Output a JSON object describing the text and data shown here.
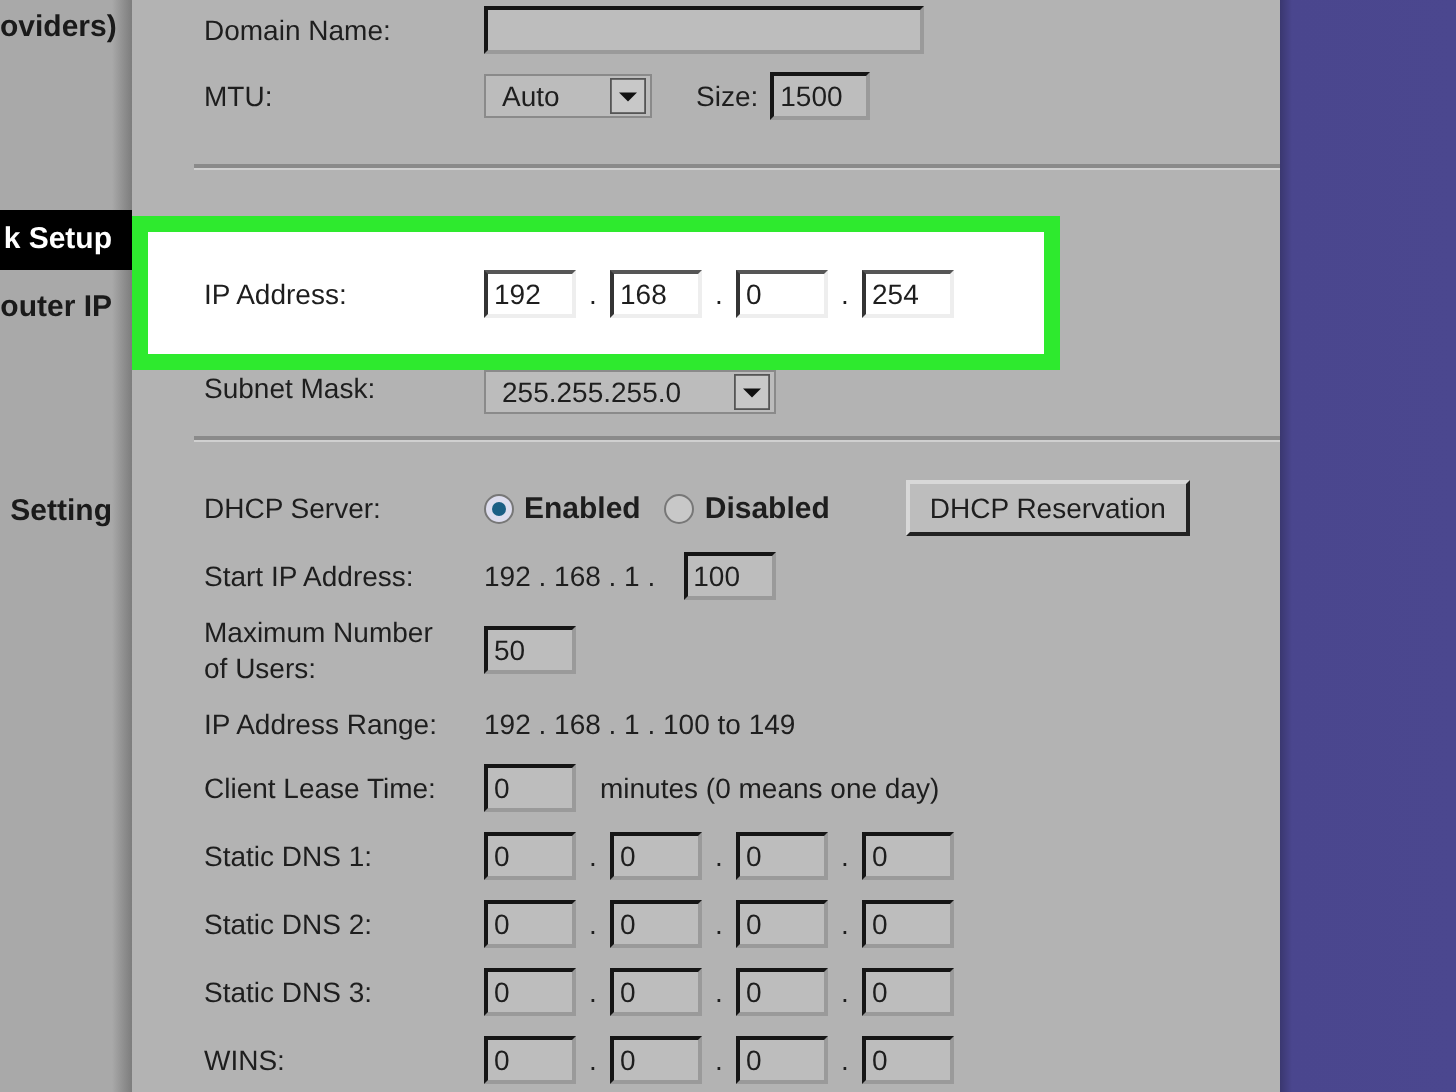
{
  "sidebar": {
    "items": [
      {
        "label": "oviders)",
        "selected": false
      },
      {
        "label": "k Setup",
        "selected": true
      },
      {
        "label": "outer IP",
        "selected": false
      },
      {
        "label": "Setting",
        "selected": false
      }
    ]
  },
  "form": {
    "rows": [
      {
        "kind": "fields",
        "label": "Domain Name:",
        "parts": [
          {
            "kind": "wide-field"
          }
        ]
      },
      {
        "kind": "fields",
        "label": "MTU:",
        "parts": [
          {
            "kind": "select",
            "value": "Auto"
          },
          {
            "kind": "text",
            "value": "Size:"
          },
          {
            "kind": "field",
            "value": "1500"
          }
        ]
      },
      {
        "kind": "divider"
      },
      {
        "kind": "highlight",
        "label": "IP Address:",
        "parts": [
          {
            "kind": "field",
            "value": "192"
          },
          {
            "kind": "dot",
            "value": "."
          },
          {
            "kind": "field",
            "value": "168"
          },
          {
            "kind": "dot",
            "value": "."
          },
          {
            "kind": "field",
            "value": "0"
          },
          {
            "kind": "dot",
            "value": "."
          },
          {
            "kind": "field",
            "value": "254"
          }
        ]
      },
      {
        "kind": "fields",
        "label": "Subnet Mask:",
        "parts": [
          {
            "kind": "wide-select",
            "value": "255.255.255.0"
          }
        ]
      },
      {
        "kind": "divider"
      },
      {
        "kind": "fields",
        "label": "DHCP Server:",
        "parts": [
          {
            "kind": "radio",
            "label": "Enabled",
            "selected": true
          },
          {
            "kind": "radio",
            "label": "Disabled",
            "selected": false
          },
          {
            "kind": "button",
            "label": "DHCP Reservation"
          }
        ]
      },
      {
        "kind": "fields",
        "label": "Start IP Address:",
        "parts": [
          {
            "kind": "text",
            "value": "192 . 168 . 1 ."
          },
          {
            "kind": "field",
            "value": "100"
          }
        ]
      },
      {
        "kind": "fields",
        "label": "Maximum Number of Users:",
        "parts": [
          {
            "kind": "field",
            "value": "50"
          }
        ]
      },
      {
        "kind": "fields",
        "label": "IP Address Range:",
        "parts": [
          {
            "kind": "text",
            "value": "192 . 168 . 1 . 100 to 149"
          }
        ]
      },
      {
        "kind": "fields",
        "label": "Client Lease Time:",
        "parts": [
          {
            "kind": "field",
            "value": "0"
          },
          {
            "kind": "text",
            "value": "minutes (0 means one day)"
          }
        ]
      },
      {
        "kind": "fields",
        "label": "Static DNS 1:",
        "parts": [
          {
            "kind": "field",
            "value": "0"
          },
          {
            "kind": "dot",
            "value": "."
          },
          {
            "kind": "field",
            "value": "0"
          },
          {
            "kind": "dot",
            "value": "."
          },
          {
            "kind": "field",
            "value": "0"
          },
          {
            "kind": "dot",
            "value": "."
          },
          {
            "kind": "field",
            "value": "0"
          }
        ]
      },
      {
        "kind": "fields",
        "label": "Static DNS 2:",
        "parts": [
          {
            "kind": "field",
            "value": "0"
          },
          {
            "kind": "dot",
            "value": "."
          },
          {
            "kind": "field",
            "value": "0"
          },
          {
            "kind": "dot",
            "value": "."
          },
          {
            "kind": "field",
            "value": "0"
          },
          {
            "kind": "dot",
            "value": "."
          },
          {
            "kind": "field",
            "value": "0"
          }
        ]
      },
      {
        "kind": "fields",
        "label": "Static DNS 3:",
        "parts": [
          {
            "kind": "field",
            "value": "0"
          },
          {
            "kind": "dot",
            "value": "."
          },
          {
            "kind": "field",
            "value": "0"
          },
          {
            "kind": "dot",
            "value": "."
          },
          {
            "kind": "field",
            "value": "0"
          },
          {
            "kind": "dot",
            "value": "."
          },
          {
            "kind": "field",
            "value": "0"
          }
        ]
      },
      {
        "kind": "fields",
        "label": "WINS:",
        "parts": [
          {
            "kind": "field",
            "value": "0"
          },
          {
            "kind": "dot",
            "value": "."
          },
          {
            "kind": "field",
            "value": "0"
          },
          {
            "kind": "dot",
            "value": "."
          },
          {
            "kind": "field",
            "value": "0"
          },
          {
            "kind": "dot",
            "value": "."
          },
          {
            "kind": "field",
            "value": "0"
          }
        ]
      }
    ]
  }
}
